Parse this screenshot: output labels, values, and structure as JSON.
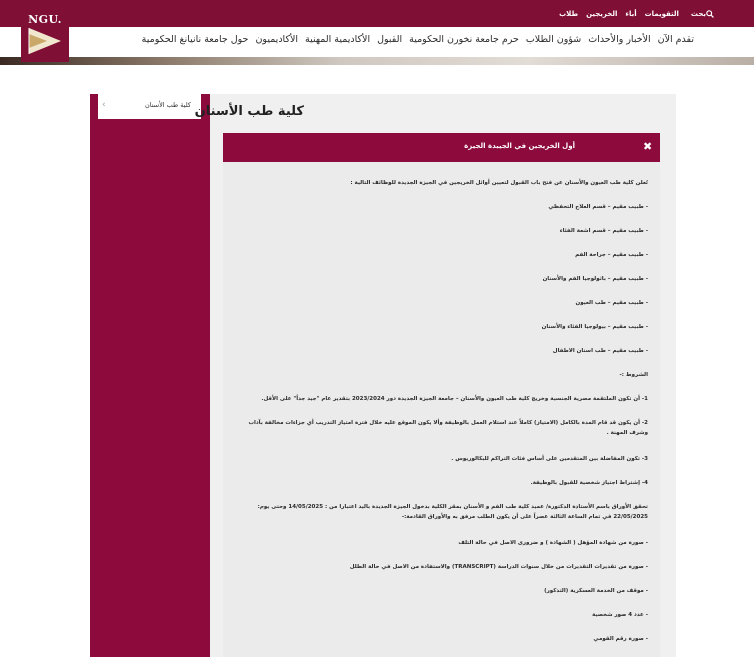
{
  "topbar": {
    "logo_text": "NGU.",
    "links": [
      "التقويمات",
      "أباء",
      "الخريجين",
      "طلاب"
    ],
    "search_label": "بحث"
  },
  "nav": {
    "items": [
      "تقدم الآن",
      "الأخبار والأحداث",
      "شؤون الطلاب",
      "حرم جامعة نخورن الحكومية",
      "القبول",
      "الأكاديمية المهنية",
      "الأكاديميون",
      "حول جامعة نانيانغ الحكومية"
    ]
  },
  "sidebar": {
    "items": [
      {
        "label": "كلية طب الأسنان",
        "icon": "chevron-left-icon"
      }
    ]
  },
  "page": {
    "title": "كلية طب الأسنان"
  },
  "accordion": {
    "title": "أول الخريجين في الجيبدة الجيزة",
    "close_glyph": "✖",
    "lines": [
      "تُعلن كلية طب العيون والأسنان عن فتح باب القبول لتعيين أوائل الخريجين في الجيزة الجديدة للوظائف التالية :",
      "- طبيب مقيم – قسم العلاج التحفظي",
      "- طبيب مقيم – قسم اشعة الفئاء",
      "- طبيب مقيم – جراحة الفم",
      "- طبيب مقيم – باثولوجيا الفم والأسنان",
      "- طبيب مقيم – طب العيون",
      "- طبيب مقيم – بيولوجيا الفئاء والأسنان",
      "- طبيب مقيم – طب اسنان الاطفال",
      "الشروط :-",
      "1- أن تكون الملتقمة مصرية الجنسية وخريج كلية طب العيون والأسنان – جامعة الجيزة الجديدة دور 2023/2024 بتقدير عام \"جيد جداً\" على الأقل.",
      "2- أن يكون قد قام المدة بالكامل (الامتياز) كاملاً عند استلام العمل بالوظيفة وألا يكون الموقع عليه خلال فترة امتياز التدريب أي جزاءات مخالفة بآداب وشرف المهنة .",
      "3- تكون المفاضلة بين المتقدمين على أساس فئات التراكم للبكالوريوس .",
      "4- إشتراط اجتياز شخصية للقبول بالوظيفة.",
      "تحقق الأوراق باسم الأستاذة الدكتورة/ عميد كلية طب الفم و الأسنان بمقر الكلية بدخول الجيزة الجديدة باليد اعتبارا من : 14/05/2025 وحتى يوم: 22/05/2025 في تمام الساعة الثالثة عصراً على أن يكون الطلب مرفق به والأوراق القادمة:-",
      "- صورة من شهادة المؤهل ( الشهادة ) و ضرورى الاصل في حالة التلف",
      "- صورة من تقديرات التقديرات من خلال سنوات الدراسة (TRANSCRIPT) والاستفادة من الاصل في حالة الطلل",
      "- موقف من الخدمة العسكرية (التذكور)",
      "- عدد 4 صور شخصية",
      "- صورة رقم القومي"
    ]
  }
}
